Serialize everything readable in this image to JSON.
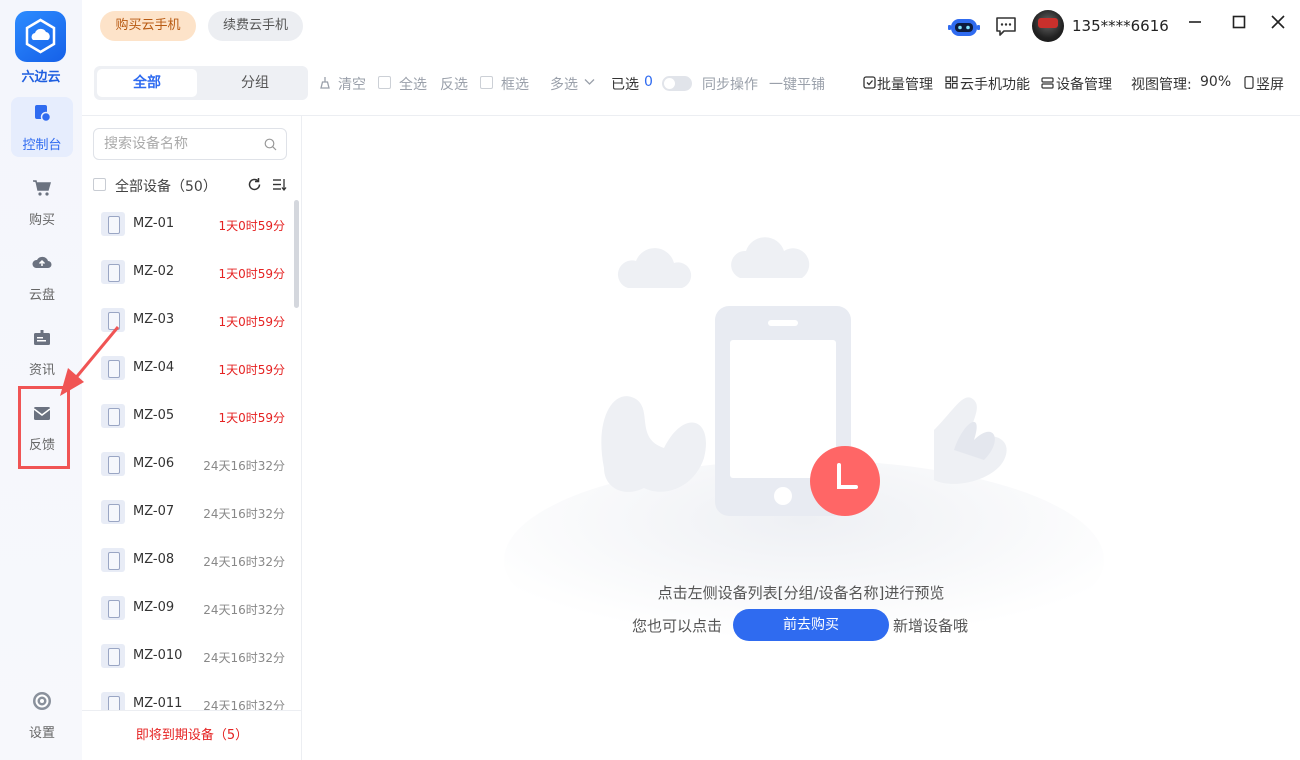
{
  "app": {
    "name": "六边云"
  },
  "nav": [
    {
      "label": "控制台",
      "icon": "console-icon",
      "active": true
    },
    {
      "label": "购买",
      "icon": "cart-icon",
      "active": false
    },
    {
      "label": "云盘",
      "icon": "cloud-upload-icon",
      "active": false
    },
    {
      "label": "资讯",
      "icon": "news-icon",
      "active": false
    },
    {
      "label": "反馈",
      "icon": "mail-icon",
      "active": false
    }
  ],
  "settings": {
    "label": "设置",
    "icon": "gear-icon"
  },
  "topbar": {
    "buy_label": "购买云手机",
    "renew_label": "续费云手机",
    "user": "135****6616"
  },
  "toolbar": {
    "tab_all": "全部",
    "tab_group": "分组",
    "clear": "清空",
    "select_all": "全选",
    "invert": "反选",
    "box_select": "框选",
    "multi": "多选",
    "selected_label": "已选",
    "selected_count": "0",
    "sync": "同步操作",
    "tile": "一键平铺",
    "batch": "批量管理",
    "phone_func": "云手机功能",
    "device_mgmt": "设备管理",
    "view_label": "视图管理:",
    "view_value": "90%",
    "portrait": "竖屏"
  },
  "panel": {
    "search_placeholder": "搜索设备名称",
    "all_devices": "全部设备（50）",
    "expiring": "即将到期设备（5）",
    "devices": [
      {
        "name": "MZ-01",
        "time": "1天0时59分",
        "urgent": true
      },
      {
        "name": "MZ-02",
        "time": "1天0时59分",
        "urgent": true
      },
      {
        "name": "MZ-03",
        "time": "1天0时59分",
        "urgent": true
      },
      {
        "name": "MZ-04",
        "time": "1天0时59分",
        "urgent": true
      },
      {
        "name": "MZ-05",
        "time": "1天0时59分",
        "urgent": true
      },
      {
        "name": "MZ-06",
        "time": "24天16时32分",
        "urgent": false
      },
      {
        "name": "MZ-07",
        "time": "24天16时32分",
        "urgent": false
      },
      {
        "name": "MZ-08",
        "time": "24天16时32分",
        "urgent": false
      },
      {
        "name": "MZ-09",
        "time": "24天16时32分",
        "urgent": false
      },
      {
        "name": "MZ-010",
        "time": "24天16时32分",
        "urgent": false
      },
      {
        "name": "MZ-011",
        "time": "24天16时32分",
        "urgent": false
      }
    ]
  },
  "empty": {
    "line1": "点击左侧设备列表[分组/设备名称]进行预览",
    "line2_prefix": "您也可以点击",
    "button": "前去购买",
    "line2_suffix": "新增设备哦"
  },
  "colors": {
    "accent": "#2f6bf0",
    "urgent": "#e52222",
    "annotation": "#f05454"
  }
}
